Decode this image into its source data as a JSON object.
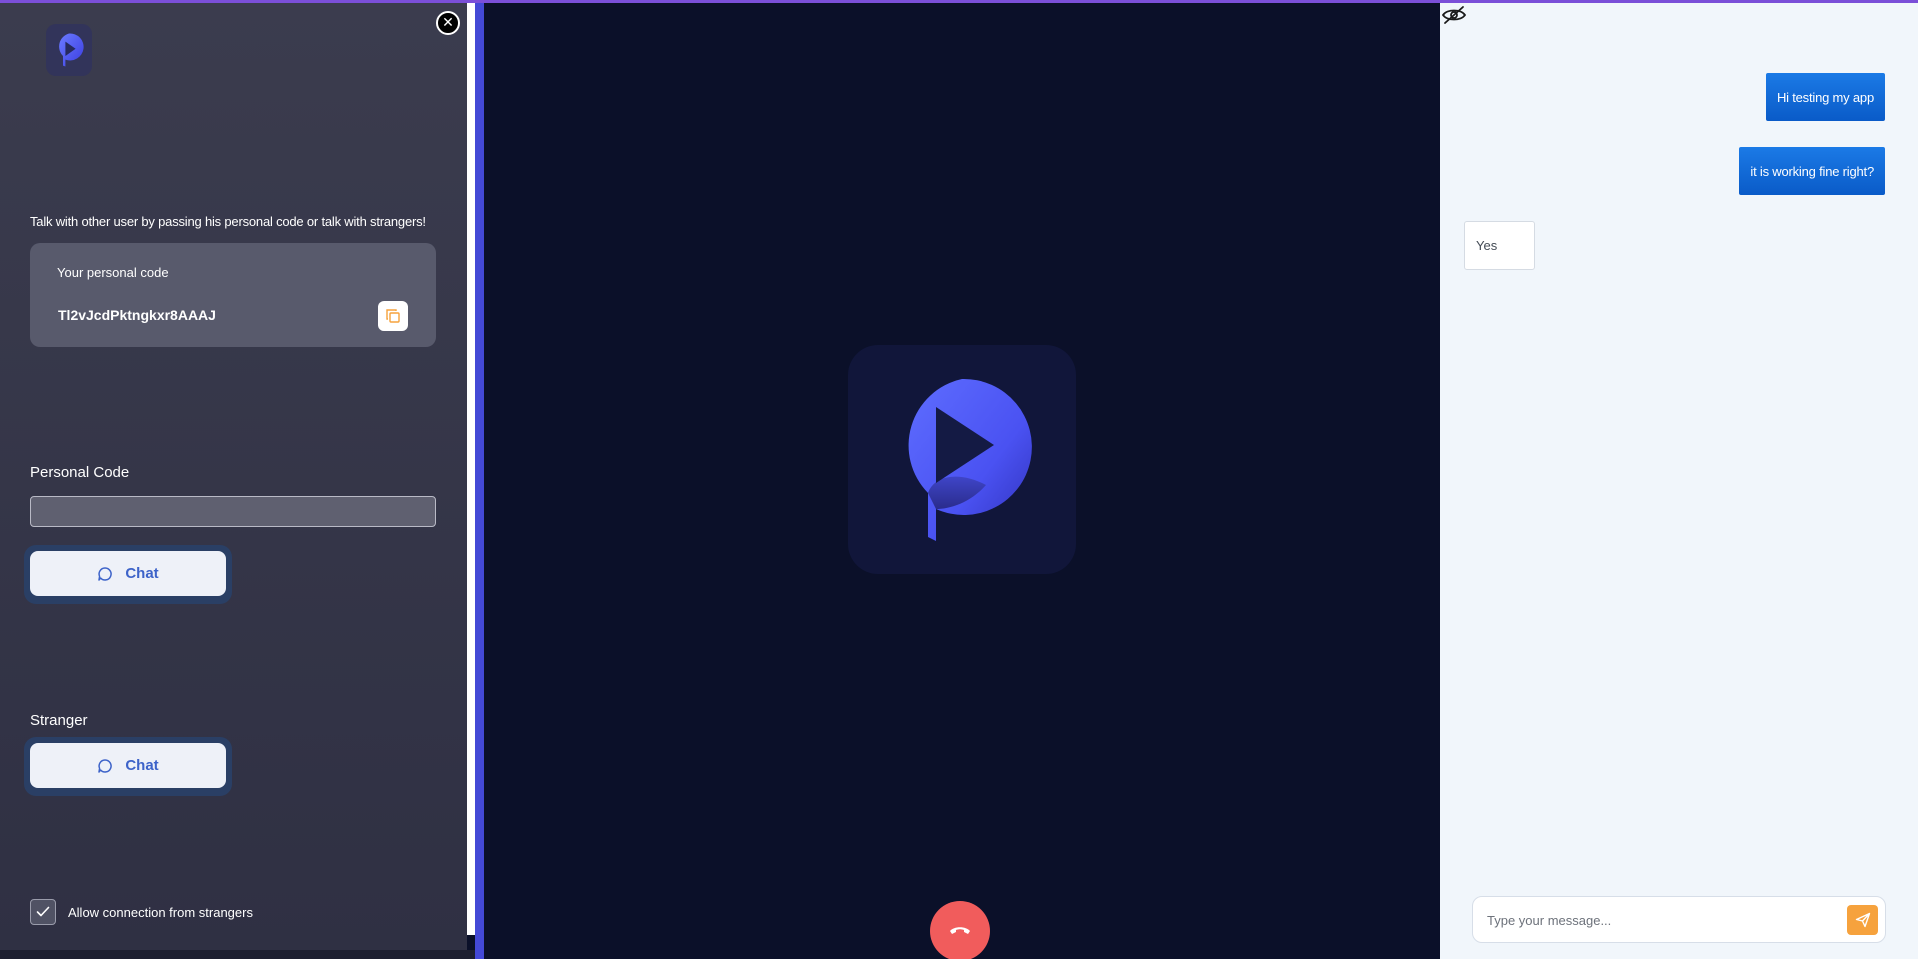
{
  "sidebar": {
    "intro_text": "Talk with other user by passing his personal code or talk with strangers!",
    "personal_code_card": {
      "label": "Your personal code",
      "code": "Tl2vJcdPktngkxr8AAAJ"
    },
    "personal_code_section": {
      "label": "Personal Code",
      "input_value": "",
      "chat_button_label": "Chat"
    },
    "stranger_section": {
      "label": "Stranger",
      "chat_button_label": "Chat"
    },
    "allow_strangers": {
      "label": "Allow connection from strangers",
      "checked": true
    }
  },
  "chat": {
    "messages": [
      {
        "direction": "outgoing",
        "text": "Hi testing my app"
      },
      {
        "direction": "outgoing",
        "text": "it is working fine right?"
      },
      {
        "direction": "incoming",
        "text": "Yes"
      }
    ],
    "input_placeholder": "Type your message..."
  },
  "icons": {
    "app_logo": "play-logo-icon",
    "close": "close-icon",
    "copy": "copy-icon",
    "chat": "chat-bubble-icon",
    "check": "check-icon",
    "hangup": "hangup-phone-icon",
    "hide_chat": "eye-off-icon",
    "send": "send-icon"
  },
  "colors": {
    "accent_blue": "#4449d6",
    "outgoing_bubble": "#0a66d0",
    "send_button": "#f6a23d",
    "hangup_button": "#f15c5c",
    "sidebar_background": "#353648",
    "video_background": "#0b1029"
  }
}
